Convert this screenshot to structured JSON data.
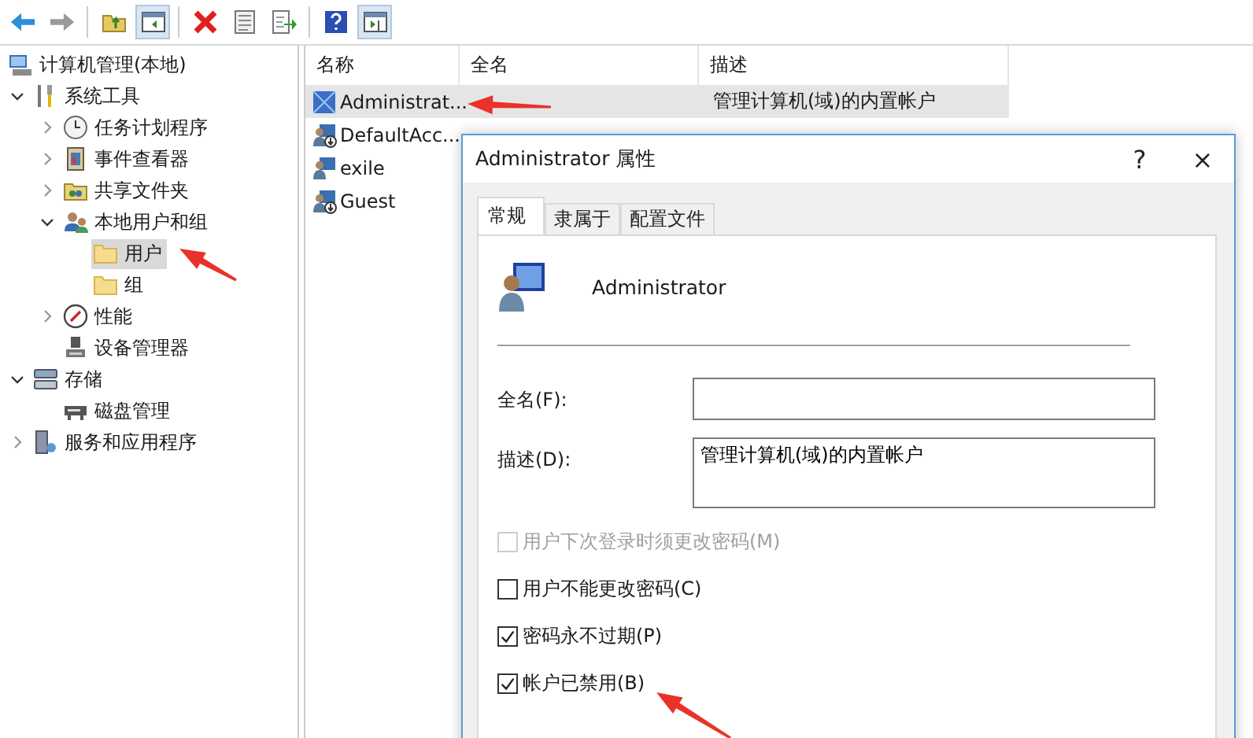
{
  "toolbar": [
    {
      "kind": "back",
      "disabled": false
    },
    {
      "kind": "forward",
      "disabled": true
    },
    {
      "kind": "up",
      "on": false
    },
    {
      "kind": "tree-toggle",
      "on": true
    },
    {
      "kind": "delete",
      "on": false
    },
    {
      "kind": "properties",
      "on": false
    },
    {
      "kind": "export",
      "on": false
    },
    {
      "kind": "help",
      "on": false
    },
    {
      "kind": "action-pane",
      "on": true
    }
  ],
  "tree": [
    {
      "label": "计算机管理(本地)",
      "kind": "computer",
      "selected": false,
      "children": [
        {
          "label": "系统工具",
          "kind": "tools",
          "expanded": true,
          "selected": false,
          "children": [
            {
              "label": "任务计划程序",
              "kind": "clock",
              "expanded": false,
              "selected": false
            },
            {
              "label": "事件查看器",
              "kind": "event",
              "expanded": false,
              "selected": false
            },
            {
              "label": "共享文件夹",
              "kind": "share",
              "expanded": false,
              "selected": false
            },
            {
              "label": "本地用户和组",
              "kind": "users",
              "expanded": true,
              "selected": false,
              "children": [
                {
                  "label": "用户",
                  "kind": "folder",
                  "selected": true
                },
                {
                  "label": "组",
                  "kind": "folder",
                  "selected": false
                }
              ]
            },
            {
              "label": "性能",
              "kind": "perf",
              "expanded": false,
              "selected": false
            },
            {
              "label": "设备管理器",
              "kind": "device",
              "selected": false
            }
          ]
        },
        {
          "label": "存储",
          "kind": "storage",
          "expanded": true,
          "selected": false,
          "children": [
            {
              "label": "磁盘管理",
              "kind": "disk",
              "selected": false
            }
          ]
        },
        {
          "label": "服务和应用程序",
          "kind": "services",
          "expanded": false,
          "selected": false
        }
      ]
    }
  ],
  "table": {
    "columns": [
      "名称",
      "全名",
      "描述"
    ],
    "rows": [
      {
        "name": "Administrat...",
        "kind": "admin",
        "description": "管理计算机(域)的内置帐户",
        "selected": true
      },
      {
        "name": "DefaultAcc...",
        "kind": "user-disabled",
        "selected": false
      },
      {
        "name": "exile",
        "kind": "user",
        "selected": false
      },
      {
        "name": "Guest",
        "kind": "user-disabled",
        "selected": false
      }
    ]
  },
  "dialog": {
    "title": "Administrator 属性",
    "help": "?",
    "close": "×",
    "tabs": [
      {
        "label": "常规",
        "selected": true
      },
      {
        "label": "隶属于",
        "selected": false
      },
      {
        "label": "配置文件",
        "selected": false
      }
    ],
    "user_name": "Administrator",
    "fields": [
      {
        "label": "全名(F):",
        "kind": "input"
      },
      {
        "label": "描述(D):",
        "value": "管理计算机(域)的内置帐户",
        "kind": "textarea"
      }
    ],
    "checkboxes": [
      {
        "label": "用户下次登录时须更改密码(M)",
        "checked": false,
        "disabled": true
      },
      {
        "label": "用户不能更改密码(C)",
        "checked": false,
        "disabled": false
      },
      {
        "label": "密码永不过期(P)",
        "checked": true,
        "disabled": false
      },
      {
        "label": "帐户已禁用(B)",
        "checked": true,
        "disabled": false
      }
    ]
  },
  "annotations": [
    {
      "kind": "arrow"
    },
    {
      "kind": "arrow"
    },
    {
      "kind": "arrow"
    }
  ]
}
